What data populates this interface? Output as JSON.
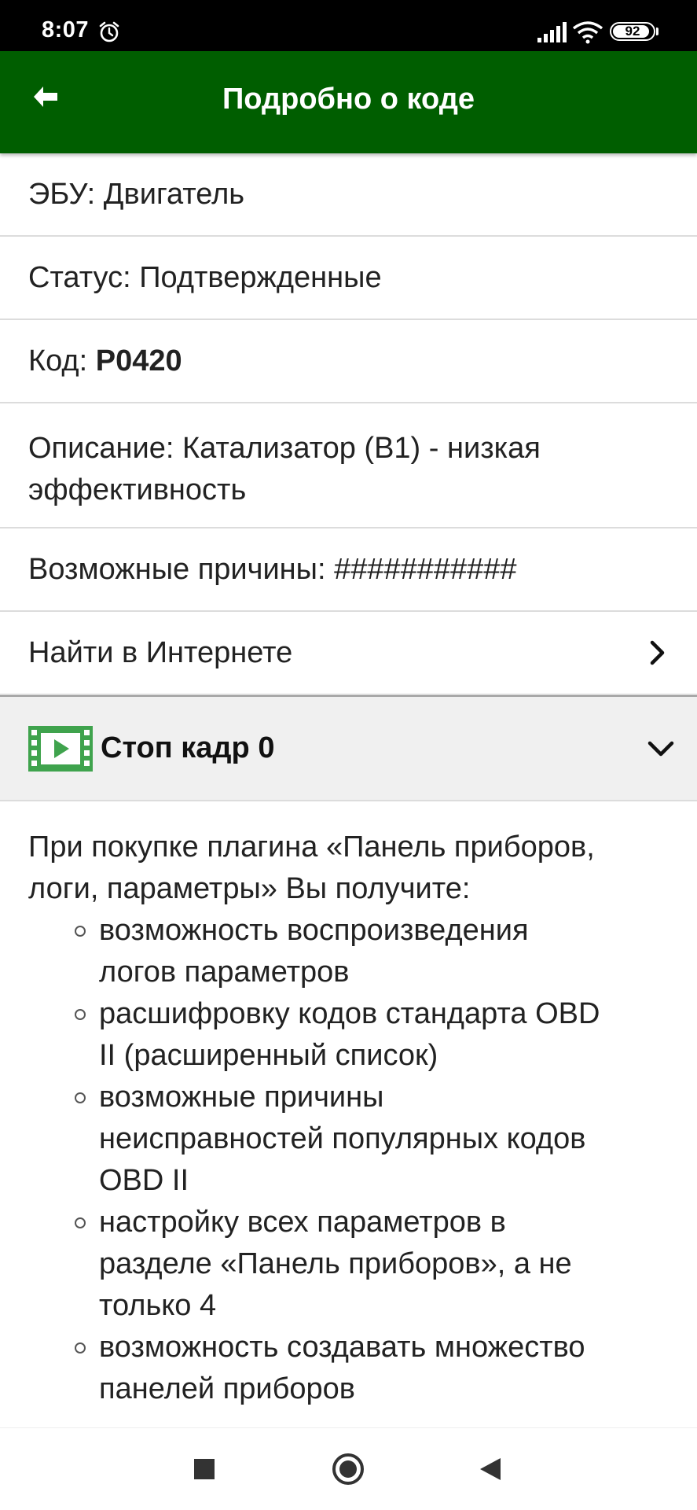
{
  "status_bar": {
    "time": "8:07",
    "battery": "92",
    "battery_level": 0.92,
    "icons": [
      "alarm-icon",
      "signal-icon",
      "wifi-icon",
      "battery-icon"
    ]
  },
  "app_bar": {
    "title": "Подробно о коде",
    "back_icon": "arrow-left-icon",
    "background": "#005e00"
  },
  "details": {
    "ecu": "ЭБУ: Двигатель",
    "status": "Статус: Подтвержденные",
    "code_label": "Код: ",
    "code_value": "P0420",
    "description_line1": "Описание: Катализатор (B1) - низкая",
    "description_line2": "эффективность",
    "causes": "Возможные причины: ###########",
    "search_online": "Найти в Интернете"
  },
  "freeze_frame": {
    "title": "Стоп кадр 0",
    "icon": "film-icon",
    "icon_color": "#3fa34d"
  },
  "promo": {
    "intro_line1": "При покупке плагина «Панель приборов,",
    "intro_line2": "логи, параметры» Вы получите:",
    "items": [
      {
        "line1": "возможность воспроизведения",
        "line2": "логов параметров",
        "line3": ""
      },
      {
        "line1": "расшифровку кодов стандарта OBD",
        "line2": "II (расширенный список)",
        "line3": ""
      },
      {
        "line1": "возможные причины",
        "line2": "неисправностей популярных кодов",
        "line3": "OBD II"
      },
      {
        "line1": "настройку всех параметров в",
        "line2": "разделе «Панель приборов», а не",
        "line3": "только 4"
      },
      {
        "line1": "возможность создавать множество",
        "line2": "панелей приборов",
        "line3": ""
      }
    ]
  },
  "nav_bar": {
    "icons": [
      "recents-icon",
      "home-icon",
      "back-icon"
    ]
  }
}
